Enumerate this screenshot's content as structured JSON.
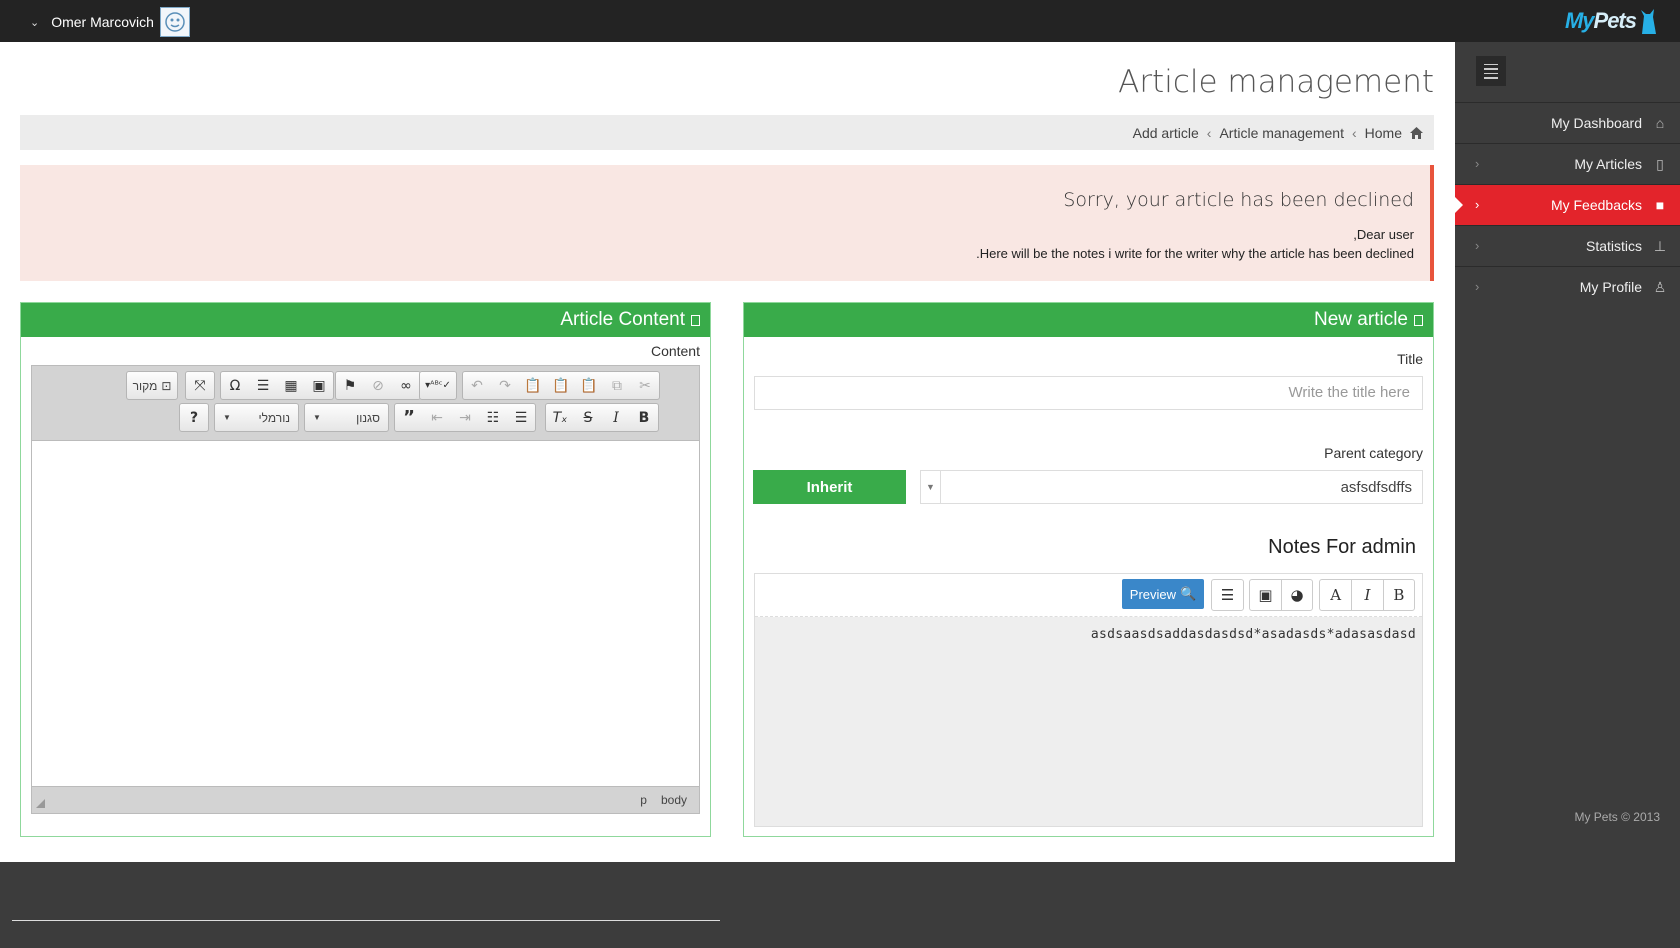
{
  "topbar": {
    "user_name": "Omer Marcovich",
    "logo_my": "My",
    "logo_pets": "Pets"
  },
  "page": {
    "title": "Article management"
  },
  "breadcrumb": {
    "home": "Home",
    "section": "Article management",
    "current": "Add article"
  },
  "alert": {
    "heading": "Sorry, your article has been declined",
    "line1": "Dear user,",
    "line2": "Here will be the notes i write for the writer why the article has been declined.",
    "accent": "#e8543c"
  },
  "content_panel": {
    "title": "Article Content",
    "content_label": "Content",
    "source_label": "מקור",
    "format_label": "נורמלי",
    "style_label": "סגנון",
    "status_body": "body",
    "status_p": "p"
  },
  "new_panel": {
    "title": "New article",
    "title_label": "Title",
    "title_placeholder": "Write the title here",
    "parent_label": "Parent category",
    "inherit_label": "Inherit",
    "parent_value": "asfsdfsdffs",
    "notes_title": "Notes For admin",
    "preview_label": "Preview",
    "notes_text": "asdsaasdsaddasdasdsd*asadasds*adasasdasd"
  },
  "sidebar": {
    "items": [
      {
        "label": "My Dashboard",
        "icon": "home-icon"
      },
      {
        "label": "My Articles",
        "icon": "file-icon"
      },
      {
        "label": "My Feedbacks",
        "icon": "folder-icon"
      },
      {
        "label": "Statistics",
        "icon": "sitemap-icon"
      },
      {
        "label": "My Profile",
        "icon": "user-icon"
      }
    ],
    "active_index": 2,
    "copyright": "My Pets © 2013"
  },
  "colors": {
    "green": "#39ab4a",
    "red_active": "#e3242b",
    "preview_blue": "#3a87c9"
  }
}
